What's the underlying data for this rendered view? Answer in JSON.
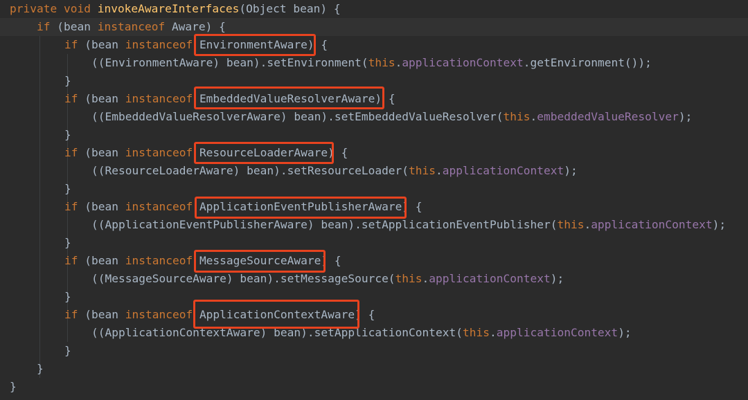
{
  "editor": {
    "colors": {
      "background": "#2b2b2b",
      "current_line": "#323232",
      "keyword": "#cc7832",
      "method_decl": "#ffc66d",
      "field": "#9876aa",
      "plain": "#a9b7c6",
      "highlight_box": "#e8431f"
    },
    "lines": [
      {
        "segments": [
          {
            "t": "private void ",
            "c": "kw"
          },
          {
            "t": "invokeAwareInterfaces",
            "c": "fn"
          },
          {
            "t": "(Object bean) {",
            "c": "plain"
          }
        ]
      },
      {
        "segments": [
          {
            "t": "if ",
            "c": "kw"
          },
          {
            "t": "(bean ",
            "c": "plain"
          },
          {
            "t": "instanceof ",
            "c": "kw"
          },
          {
            "t": "Aware) {",
            "c": "plain"
          }
        ]
      },
      {
        "segments": [
          {
            "t": "if ",
            "c": "kw"
          },
          {
            "t": "(bean ",
            "c": "plain"
          },
          {
            "t": "instanceof ",
            "c": "kw"
          },
          {
            "t": "EnvironmentAware) {",
            "c": "plain"
          }
        ]
      },
      {
        "segments": [
          {
            "t": "((EnvironmentAware) bean).setEnvironment(",
            "c": "plain"
          },
          {
            "t": "this",
            "c": "kw"
          },
          {
            "t": ".",
            "c": "plain"
          },
          {
            "t": "applicationContext",
            "c": "field"
          },
          {
            "t": ".getEnvironment());",
            "c": "plain"
          }
        ]
      },
      {
        "segments": [
          {
            "t": "}",
            "c": "plain"
          }
        ]
      },
      {
        "segments": [
          {
            "t": "if ",
            "c": "kw"
          },
          {
            "t": "(bean ",
            "c": "plain"
          },
          {
            "t": "instanceof ",
            "c": "kw"
          },
          {
            "t": "EmbeddedValueResolverAware) {",
            "c": "plain"
          }
        ]
      },
      {
        "segments": [
          {
            "t": "((EmbeddedValueResolverAware) bean).setEmbeddedValueResolver(",
            "c": "plain"
          },
          {
            "t": "this",
            "c": "kw"
          },
          {
            "t": ".",
            "c": "plain"
          },
          {
            "t": "embeddedValueResolver",
            "c": "field"
          },
          {
            "t": ");",
            "c": "plain"
          }
        ]
      },
      {
        "segments": [
          {
            "t": "}",
            "c": "plain"
          }
        ]
      },
      {
        "segments": [
          {
            "t": "if ",
            "c": "kw"
          },
          {
            "t": "(bean ",
            "c": "plain"
          },
          {
            "t": "instanceof ",
            "c": "kw"
          },
          {
            "t": "ResourceLoaderAware) {",
            "c": "plain"
          }
        ]
      },
      {
        "segments": [
          {
            "t": "((ResourceLoaderAware) bean).setResourceLoader(",
            "c": "plain"
          },
          {
            "t": "this",
            "c": "kw"
          },
          {
            "t": ".",
            "c": "plain"
          },
          {
            "t": "applicationContext",
            "c": "field"
          },
          {
            "t": ");",
            "c": "plain"
          }
        ]
      },
      {
        "segments": [
          {
            "t": "}",
            "c": "plain"
          }
        ]
      },
      {
        "segments": [
          {
            "t": "if ",
            "c": "kw"
          },
          {
            "t": "(bean ",
            "c": "plain"
          },
          {
            "t": "instanceof ",
            "c": "kw"
          },
          {
            "t": "ApplicationEventPublisherAware) {",
            "c": "plain"
          }
        ]
      },
      {
        "segments": [
          {
            "t": "((ApplicationEventPublisherAware) bean).setApplicationEventPublisher(",
            "c": "plain"
          },
          {
            "t": "this",
            "c": "kw"
          },
          {
            "t": ".",
            "c": "plain"
          },
          {
            "t": "applicationContext",
            "c": "field"
          },
          {
            "t": ");",
            "c": "plain"
          }
        ]
      },
      {
        "segments": [
          {
            "t": "}",
            "c": "plain"
          }
        ]
      },
      {
        "segments": [
          {
            "t": "if ",
            "c": "kw"
          },
          {
            "t": "(bean ",
            "c": "plain"
          },
          {
            "t": "instanceof ",
            "c": "kw"
          },
          {
            "t": "MessageSourceAware) {",
            "c": "plain"
          }
        ]
      },
      {
        "segments": [
          {
            "t": "((MessageSourceAware) bean).setMessageSource(",
            "c": "plain"
          },
          {
            "t": "this",
            "c": "kw"
          },
          {
            "t": ".",
            "c": "plain"
          },
          {
            "t": "applicationContext",
            "c": "field"
          },
          {
            "t": ");",
            "c": "plain"
          }
        ]
      },
      {
        "segments": [
          {
            "t": "}",
            "c": "plain"
          }
        ]
      },
      {
        "segments": [
          {
            "t": "if ",
            "c": "kw"
          },
          {
            "t": "(bean ",
            "c": "plain"
          },
          {
            "t": "instanceof ",
            "c": "kw"
          },
          {
            "t": "ApplicationContextAware) {",
            "c": "plain"
          }
        ]
      },
      {
        "segments": [
          {
            "t": "((ApplicationContextAware) bean).setApplicationContext(",
            "c": "plain"
          },
          {
            "t": "this",
            "c": "kw"
          },
          {
            "t": ".",
            "c": "plain"
          },
          {
            "t": "applicationContext",
            "c": "field"
          },
          {
            "t": ");",
            "c": "plain"
          }
        ]
      },
      {
        "segments": [
          {
            "t": "}",
            "c": "plain"
          }
        ]
      },
      {
        "segments": [
          {
            "t": "}",
            "c": "plain"
          }
        ]
      },
      {
        "segments": [
          {
            "t": "}",
            "c": "plain"
          }
        ]
      }
    ]
  }
}
